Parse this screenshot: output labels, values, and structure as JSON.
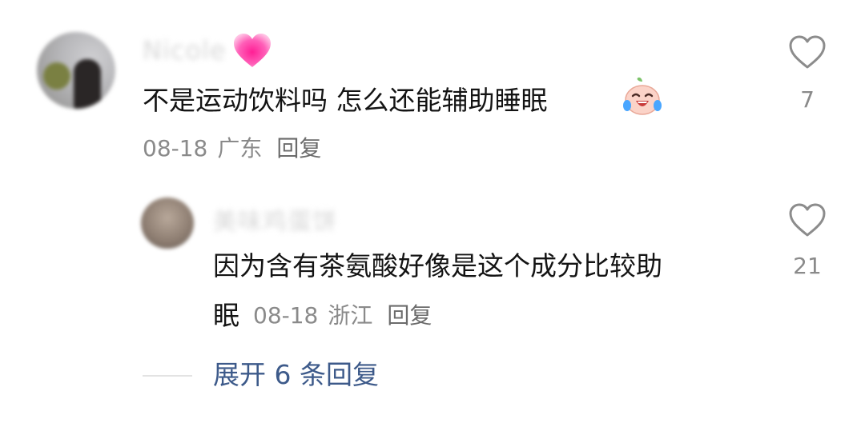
{
  "comments": [
    {
      "username": "Nicole",
      "text": "不是运动饮料吗 怎么还能辅助睡眠",
      "date": "08-18",
      "location": "广东",
      "reply_label": "回复",
      "likes": "7",
      "name_emoji": "pink-heart-icon",
      "text_emoji": "laughing-crying-face-icon"
    },
    {
      "username": "美味鸡蛋饼",
      "text_line1": "因为含有茶氨酸好像是这个成分比较助",
      "text_line2": "眠",
      "date": "08-18",
      "location": "浙江",
      "reply_label": "回复",
      "likes": "21"
    }
  ],
  "expand_replies": "展开 6 条回复",
  "colors": {
    "text": "#141414",
    "meta": "#8a8a8a",
    "link": "#3d5a8a",
    "heart_pink": "#ff5fb0"
  }
}
